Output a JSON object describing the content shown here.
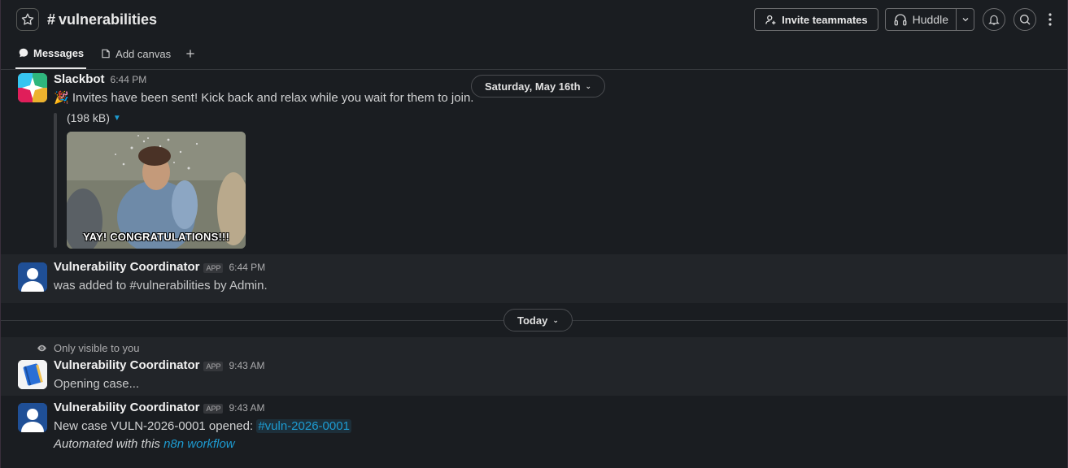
{
  "header": {
    "channel_hash": "#",
    "channel_name": "vulnerabilities",
    "invite_label": "Invite teammates",
    "huddle_label": "Huddle"
  },
  "tabs": [
    {
      "label": "Messages",
      "active": true
    },
    {
      "label": "Add canvas",
      "active": false
    }
  ],
  "date_separators": [
    {
      "label": "Saturday, May 16th"
    },
    {
      "label": "Today"
    }
  ],
  "messages": [
    {
      "author": "Slackbot",
      "time": "6:44 PM",
      "emoji": "🎉",
      "text": "Invites have been sent! Kick back and relax while you wait for them to join.",
      "file_size": "(198 kB)",
      "gif_caption": "YAY! CONGRATULATIONS!!!"
    },
    {
      "author": "Vulnerability Coordinator",
      "badge": "APP",
      "time": "6:44 PM",
      "text": "was added to #vulnerabilities by Admin."
    },
    {
      "notice": "Only visible to you",
      "author": "Vulnerability Coordinator",
      "badge": "APP",
      "time": "9:43 AM",
      "text": "Opening case..."
    },
    {
      "author": "Vulnerability Coordinator",
      "badge": "APP",
      "time": "9:43 AM",
      "text_prefix": "New case VULN-2026-0001 opened: ",
      "channel_link": "#vuln-2026-0001",
      "footer_prefix": "Automated with this ",
      "footer_link": "n8n workflow"
    }
  ],
  "colors": {
    "background": "#1a1d21",
    "link": "#1d9bd1",
    "highlight_row": "#222529"
  }
}
